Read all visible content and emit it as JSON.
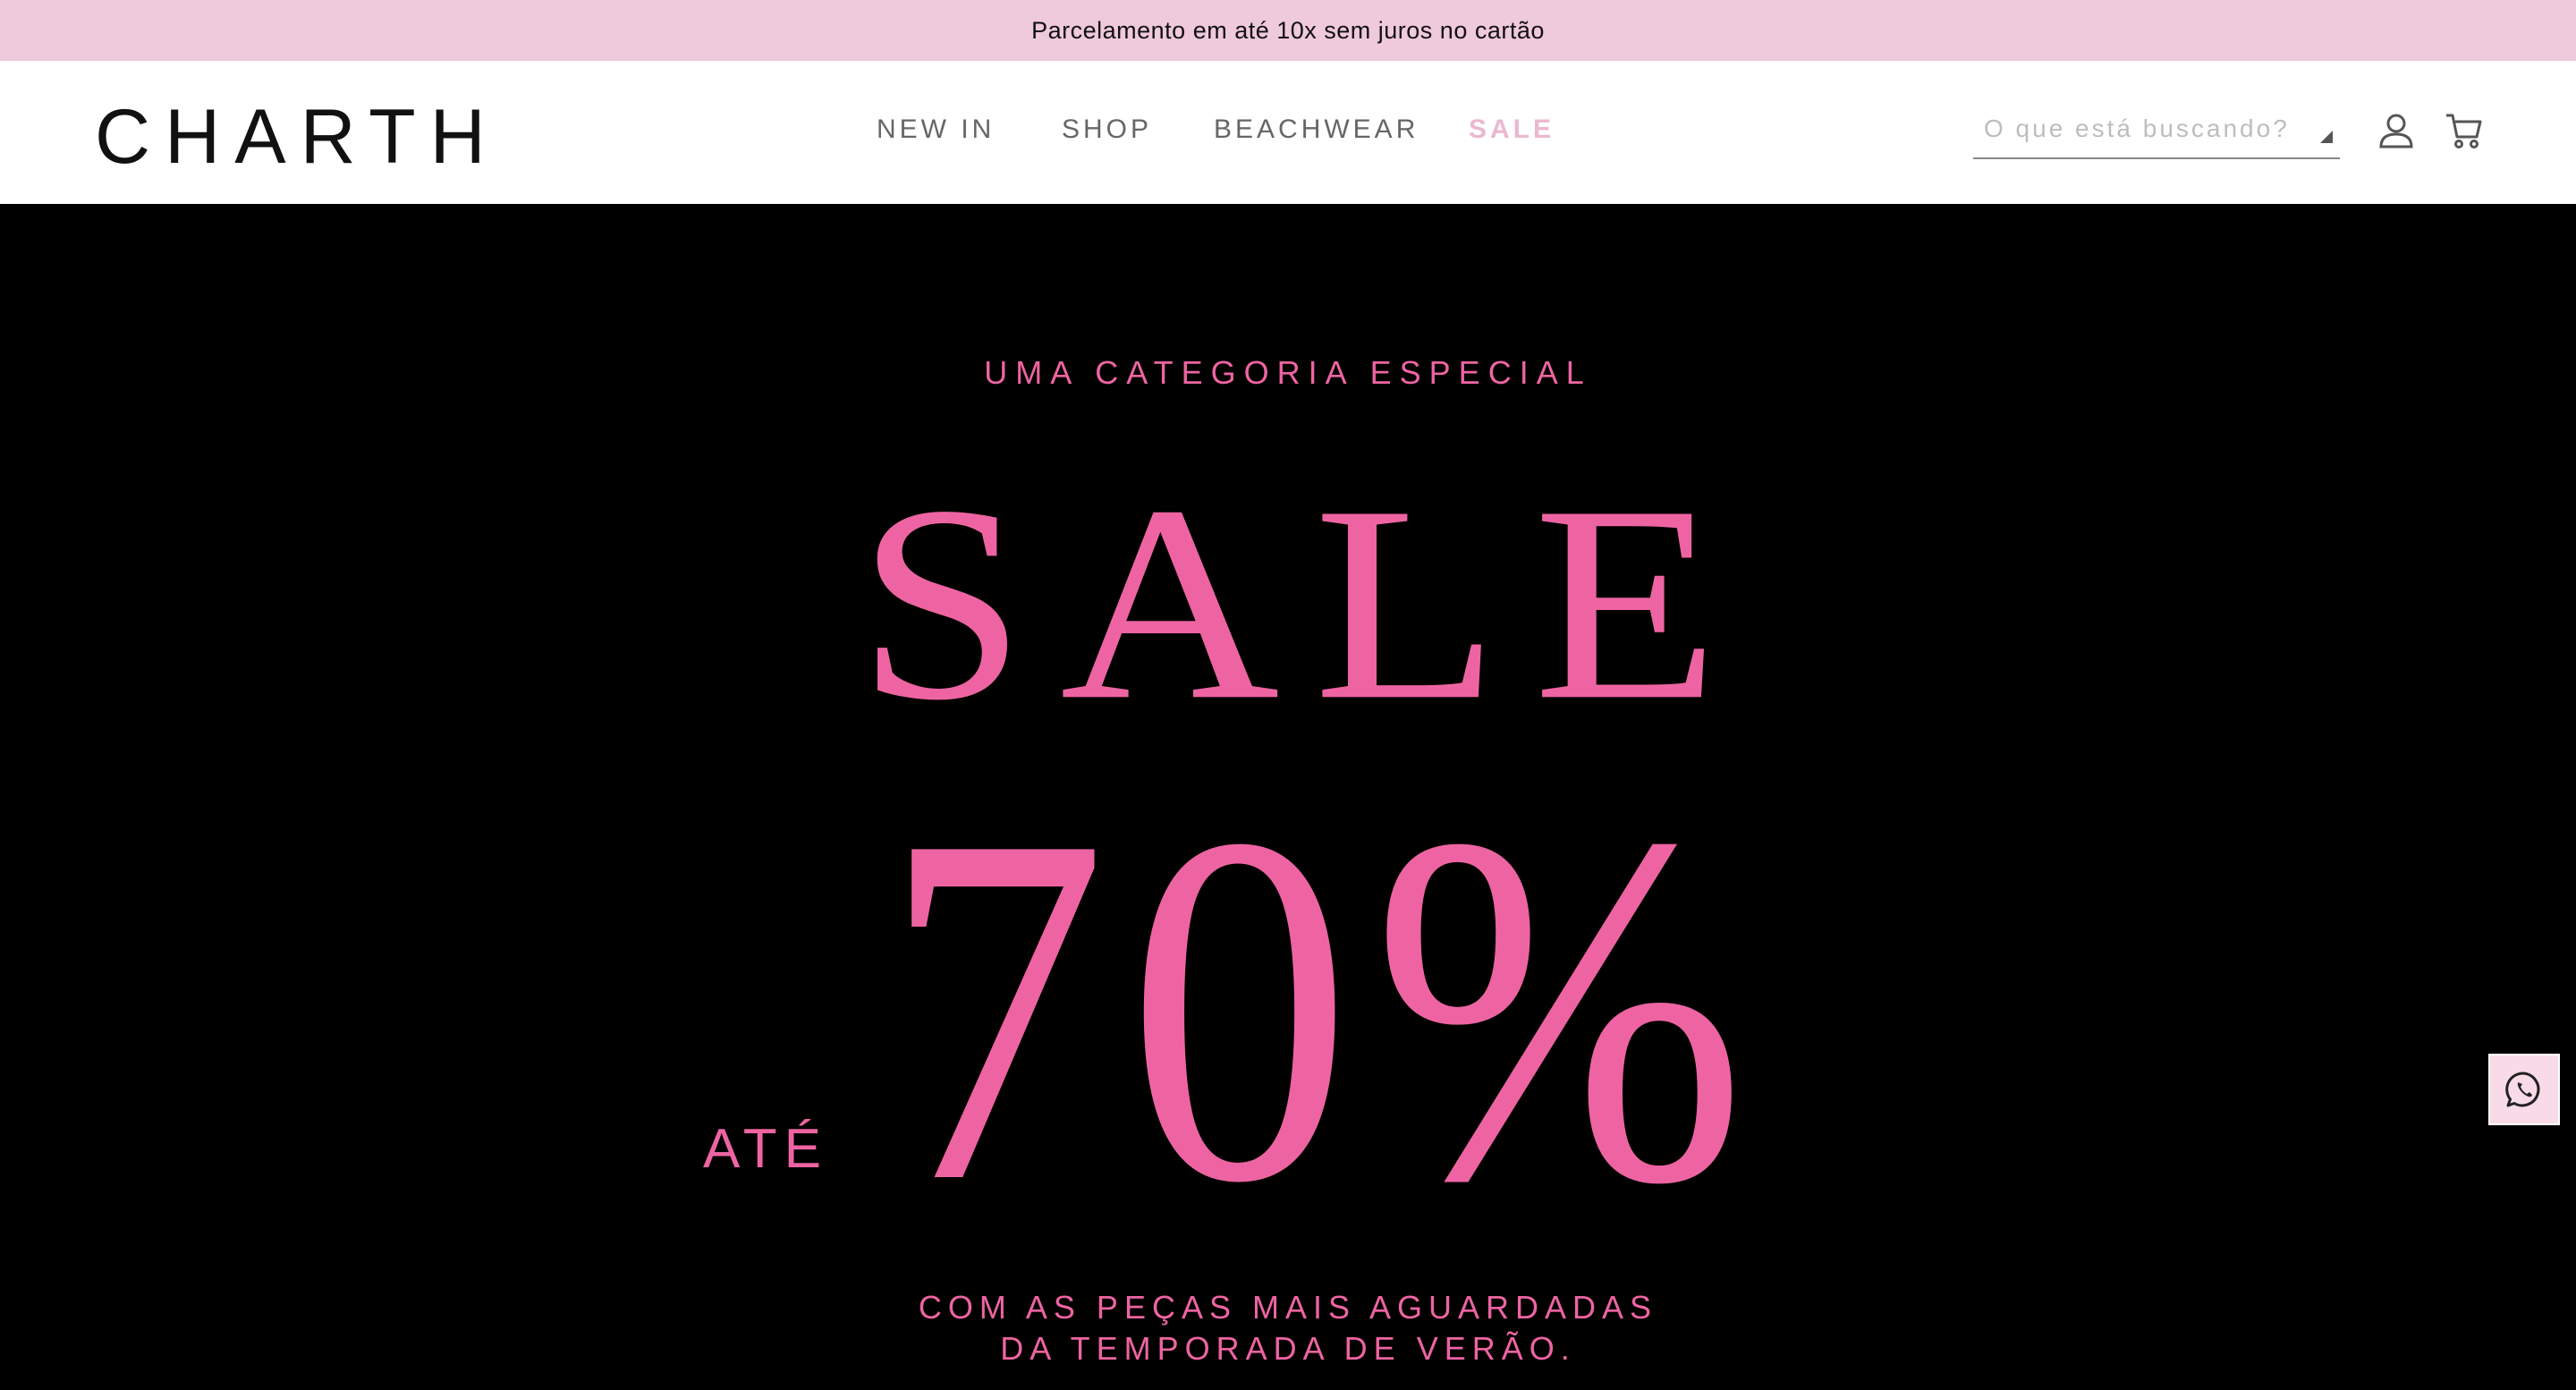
{
  "announcement": {
    "text": "Parcelamento em até 10x sem juros no cartão"
  },
  "header": {
    "logo": "CHARTH",
    "nav": [
      {
        "label": "NEW IN"
      },
      {
        "label": "SHOP"
      },
      {
        "label": "BEACHWEAR"
      },
      {
        "label": "SALE"
      }
    ],
    "search": {
      "placeholder": "O que está buscando?",
      "value": ""
    },
    "icons": [
      "user-icon",
      "cart-icon"
    ]
  },
  "hero": {
    "eyebrow": "UMA CATEGORIA ESPECIAL",
    "headline": "SALE",
    "prefix": "ATÉ",
    "discount": "70%",
    "subline_1": "COM AS PEÇAS MAIS AGUARDADAS",
    "subline_2": "DA TEMPORADA DE VERÃO."
  },
  "floating": {
    "icon": "whatsapp-icon"
  },
  "colors": {
    "topbar_bg": "#efc9dc",
    "accent_pink": "#ee64a2",
    "sale_nav": "#ebb8cf",
    "hero_bg": "#000000"
  }
}
